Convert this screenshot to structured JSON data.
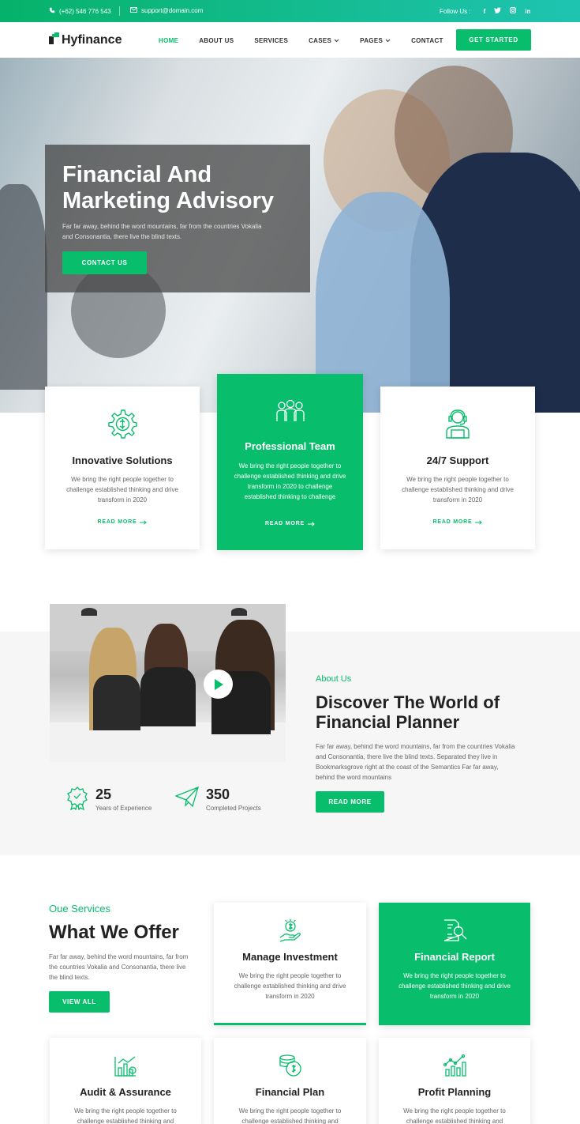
{
  "topbar": {
    "phone": "(+62) 546 776 543",
    "email": "support@domain.com",
    "follow_label": "Follow Us :",
    "social_icons": [
      "facebook-icon",
      "twitter-icon",
      "instagram-icon",
      "linkedin-icon"
    ]
  },
  "header": {
    "logo": "Hyfinance",
    "nav": [
      {
        "label": "HOME",
        "active": true
      },
      {
        "label": "ABOUT US"
      },
      {
        "label": "SERVICES"
      },
      {
        "label": "CASES",
        "dropdown": true
      },
      {
        "label": "PAGES",
        "dropdown": true
      },
      {
        "label": "CONTACT"
      }
    ],
    "cta": "GET STARTED"
  },
  "hero": {
    "title_line1": "Financial And",
    "title_line2": "Marketing Advisory",
    "text": "Far far away, behind the word mountains, far from the countries Vokalia and Consonantia, there live the blind texts.",
    "button": "CONTACT US"
  },
  "feature_cards": [
    {
      "icon": "gear-brain-icon",
      "title": "Innovative Solutions",
      "text": "We bring the right people together to challenge established thinking and drive transform in 2020",
      "link": "READ MORE"
    },
    {
      "icon": "team-icon",
      "title": "Professional Team",
      "text": "We bring the right people together to challenge established thinking and drive transform in 2020 to challenge established thinking to challenge",
      "link": "READ MORE"
    },
    {
      "icon": "support-agent-icon",
      "title": "24/7 Support",
      "text": "We bring the right people together to challenge established thinking and drive transform in 2020",
      "link": "READ MORE"
    }
  ],
  "about": {
    "subtitle": "About Us",
    "title_line1": "Discover The World of",
    "title_line2": "Financial Planner",
    "text": "Far far away, behind the word mountains, far from the countries Vokalia and Consonantia, there live the blind texts. Separated they live in Bookmarksgrove right at the coast of the Semantics Far far away, behind the word mountains",
    "button": "READ MORE",
    "stats": [
      {
        "icon": "award-badge-icon",
        "value": "25",
        "label": "Years of Experience"
      },
      {
        "icon": "paper-plane-icon",
        "value": "350",
        "label": "Completed Projects"
      }
    ]
  },
  "services": {
    "subtitle": "Oue Services",
    "title": "What We Offer",
    "text": "Far far away, behind the word mountains, far from the countries Vokalia and Consonantia, there live the blind texts.",
    "button": "VIEW ALL",
    "cards": [
      {
        "icon": "money-hand-icon",
        "title": "Manage Investment",
        "text": "We bring the right people together to challenge established thinking and drive transform in 2020"
      },
      {
        "icon": "report-search-icon",
        "title": "Financial Report",
        "text": "We bring the right people together to challenge established thinking and drive transform in 2020"
      },
      {
        "icon": "bar-chart-icon",
        "title": "Audit & Assurance",
        "text": "We bring the right people together to challenge established thinking and"
      },
      {
        "icon": "coins-icon",
        "title": "Financial Plan",
        "text": "We bring the right people together to challenge established thinking and"
      },
      {
        "icon": "growth-chart-icon",
        "title": "Profit Planning",
        "text": "We bring the right people together to challenge established thinking and"
      }
    ]
  },
  "colors": {
    "accent": "#08bd6b",
    "dark": "#222222"
  }
}
